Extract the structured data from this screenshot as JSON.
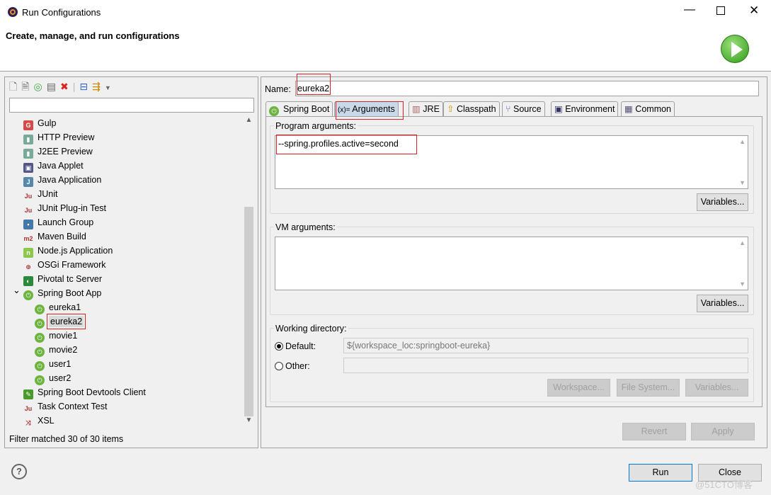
{
  "window": {
    "title": "Run Configurations",
    "header": "Create, manage, and run configurations"
  },
  "left": {
    "filter_placeholder": "",
    "status": "Filter matched 30 of 30 items",
    "tree": [
      {
        "label": "Gulp",
        "icon": "gulp-icon",
        "level": 0
      },
      {
        "label": "HTTP Preview",
        "icon": "http-preview-icon",
        "level": 0
      },
      {
        "label": "J2EE Preview",
        "icon": "j2ee-preview-icon",
        "level": 0
      },
      {
        "label": "Java Applet",
        "icon": "java-applet-icon",
        "level": 0
      },
      {
        "label": "Java Application",
        "icon": "java-application-icon",
        "level": 0
      },
      {
        "label": "JUnit",
        "icon": "junit-icon",
        "level": 0
      },
      {
        "label": "JUnit Plug-in Test",
        "icon": "junit-plugin-icon",
        "level": 0
      },
      {
        "label": "Launch Group",
        "icon": "launch-group-icon",
        "level": 0
      },
      {
        "label": "Maven Build",
        "icon": "maven-icon",
        "level": 0
      },
      {
        "label": "Node.js Application",
        "icon": "nodejs-icon",
        "level": 0
      },
      {
        "label": "OSGi Framework",
        "icon": "osgi-icon",
        "level": 0
      },
      {
        "label": "Pivotal tc Server",
        "icon": "pivotal-icon",
        "level": 0
      },
      {
        "label": "Spring Boot App",
        "icon": "spring-boot-icon",
        "level": 0,
        "expanded": true
      },
      {
        "label": "eureka1",
        "icon": "spring-boot-icon",
        "level": 1
      },
      {
        "label": "eureka2",
        "icon": "spring-boot-icon",
        "level": 1,
        "selected": true
      },
      {
        "label": "movie1",
        "icon": "spring-boot-icon",
        "level": 1
      },
      {
        "label": "movie2",
        "icon": "spring-boot-icon",
        "level": 1
      },
      {
        "label": "user1",
        "icon": "spring-boot-icon",
        "level": 1
      },
      {
        "label": "user2",
        "icon": "spring-boot-icon",
        "level": 1
      },
      {
        "label": "Spring Boot Devtools Client",
        "icon": "devtools-icon",
        "level": 0
      },
      {
        "label": "Task Context Test",
        "icon": "junit-icon",
        "level": 0
      },
      {
        "label": "XSL",
        "icon": "xsl-icon",
        "level": 0
      }
    ]
  },
  "right": {
    "name_label": "Name:",
    "name_value": "eureka2",
    "tabs": [
      "Spring Boot",
      "Arguments",
      "JRE",
      "Classpath",
      "Source",
      "Environment",
      "Common"
    ],
    "selected_tab": "Arguments",
    "program_args_label": "Program arguments:",
    "program_args": "--spring.profiles.active=second",
    "vm_args_label": "VM arguments:",
    "vm_args": "",
    "variables": "Variables...",
    "workdir_label": "Working directory:",
    "default_label": "Default:",
    "default_value": "${workspace_loc:springboot-eureka}",
    "other_label": "Other:",
    "workspace": "Workspace...",
    "filesystem": "File System...",
    "revert": "Revert",
    "apply": "Apply"
  },
  "footer": {
    "run": "Run",
    "close": "Close",
    "help": "?"
  },
  "watermark": "@51CTO博客"
}
